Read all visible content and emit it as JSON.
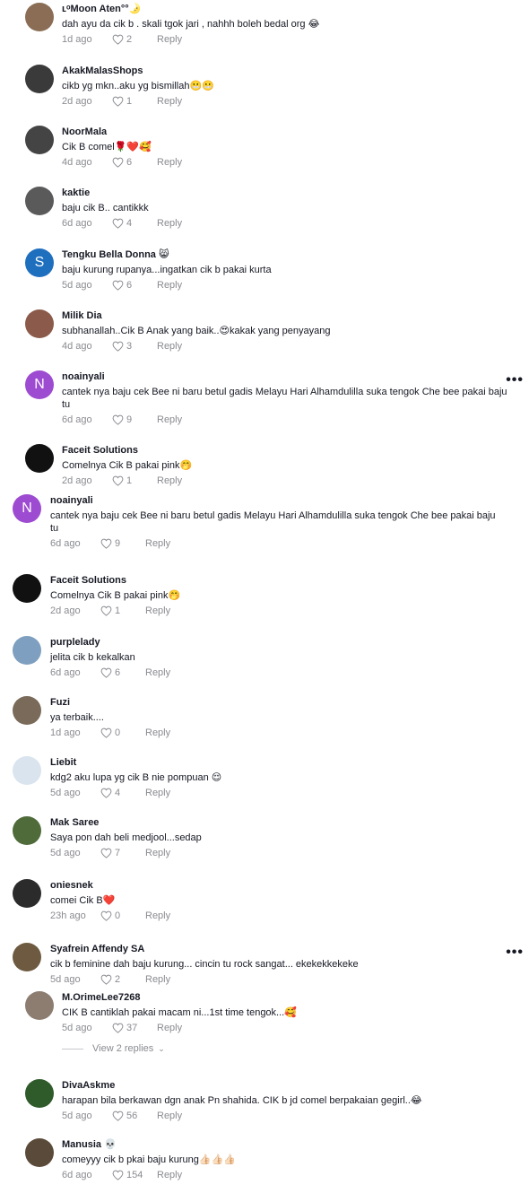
{
  "panels": [
    {
      "comments": [
        {
          "username": "ʟᵒMoon Aten°°🌛",
          "text": "dah ayu da cik b . skali tgok jari , nahhh boleh bedal org 😂",
          "time": "1d ago",
          "likes": "2",
          "avatar_color": "#8a6d54"
        },
        {
          "username": "AkakMalasShops",
          "text": "cikb yg mkn..aku yg bismillah😬😬",
          "time": "2d ago",
          "likes": "1",
          "avatar_color": "#3a3a3a"
        },
        {
          "username": "NoorMala",
          "text": "Cik B comel🌹❤️🥰",
          "time": "4d ago",
          "likes": "6",
          "avatar_color": "#444444"
        },
        {
          "username": "kaktie",
          "text": "baju cik B.. cantikkk",
          "time": "6d ago",
          "likes": "4",
          "avatar_color": "#5a5a5a"
        },
        {
          "username": "Tengku Bella Donna 😸",
          "text": "baju kurung rupanya...ingatkan cik b pakai kurta",
          "time": "5d ago",
          "likes": "6",
          "avatar_color": "#1f6fbf",
          "initial": "S"
        },
        {
          "username": "Milik Dia",
          "text": "subhanallah..Cik B Anak yang baik..😍kakak yang penyayang",
          "time": "4d ago",
          "likes": "3",
          "avatar_color": "#8b5a4a"
        },
        {
          "username": "noainyali",
          "text": "cantek nya baju cek Bee ni baru betul gadis Melayu Hari Alhamdulilla suka tengok Che bee pakai baju tu",
          "time": "6d ago",
          "likes": "9",
          "avatar_color": "#9d4bd1",
          "initial": "N",
          "more": "•••"
        },
        {
          "username": "Faceit Solutions",
          "text": "Comelnya Cik B pakai pink🤭",
          "time": "2d ago",
          "likes": "1",
          "avatar_color": "#111111"
        }
      ]
    },
    {
      "comments": [
        {
          "username": "noainyali",
          "text": "cantek nya baju cek Bee ni baru betul gadis Melayu Hari Alhamdulilla suka tengok Che bee pakai baju tu",
          "time": "6d ago",
          "likes": "9",
          "avatar_color": "#9d4bd1",
          "initial": "N"
        },
        {
          "username": "Faceit Solutions",
          "text": "Comelnya Cik B pakai pink🤭",
          "time": "2d ago",
          "likes": "1",
          "avatar_color": "#111111"
        },
        {
          "username": "purplelady",
          "text": "jelita cik b kekalkan",
          "time": "6d ago",
          "likes": "6",
          "avatar_color": "#7e9fbf"
        },
        {
          "username": "Fuzi",
          "text": "ya terbaik....",
          "time": "1d ago",
          "likes": "0",
          "avatar_color": "#7a6a5a"
        },
        {
          "username": "Liebit",
          "text": "kdg2 aku lupa yg cik B nie pompuan 😌",
          "time": "5d ago",
          "likes": "4",
          "avatar_color": "#d9e4ee"
        },
        {
          "username": "Mak Saree",
          "text": "Saya pon dah beli medjool...sedap",
          "time": "5d ago",
          "likes": "7",
          "avatar_color": "#4f6b3a"
        },
        {
          "username": "oniesnek",
          "text": "comei Cik B❤️",
          "time": "23h ago",
          "likes": "0",
          "avatar_color": "#2b2b2b"
        },
        {
          "username": "Syafrein Affendy SA",
          "text": "cik b feminine dah baju kurung... cincin tu rock sangat... ekekekkekeke",
          "time": "5d ago",
          "likes": "2",
          "avatar_color": "#6d5a40",
          "more": "•••"
        }
      ]
    },
    {
      "comments": [
        {
          "username": "M.OrimeLee7268",
          "text": "CIK B cantiklah pakai macam ni...1st time tengok...🥰",
          "time": "5d ago",
          "likes": "37",
          "avatar_color": "#8c7d70"
        },
        {
          "username": "DivaAskme",
          "text": "harapan bila berkawan dgn anak Pn shahida. CIK b jd comel berpakaian gegirl..😂",
          "time": "5d ago",
          "likes": "56",
          "avatar_color": "#2f5a2a"
        },
        {
          "username": "Manusia 💀",
          "text": "comeyyy cik b pkai baju kurung👍🏻👍🏻👍🏻",
          "time": "6d ago",
          "likes": "154",
          "avatar_color": "#5a4a3a"
        }
      ],
      "view_replies": "View 2 replies"
    }
  ],
  "reply_label": "Reply"
}
